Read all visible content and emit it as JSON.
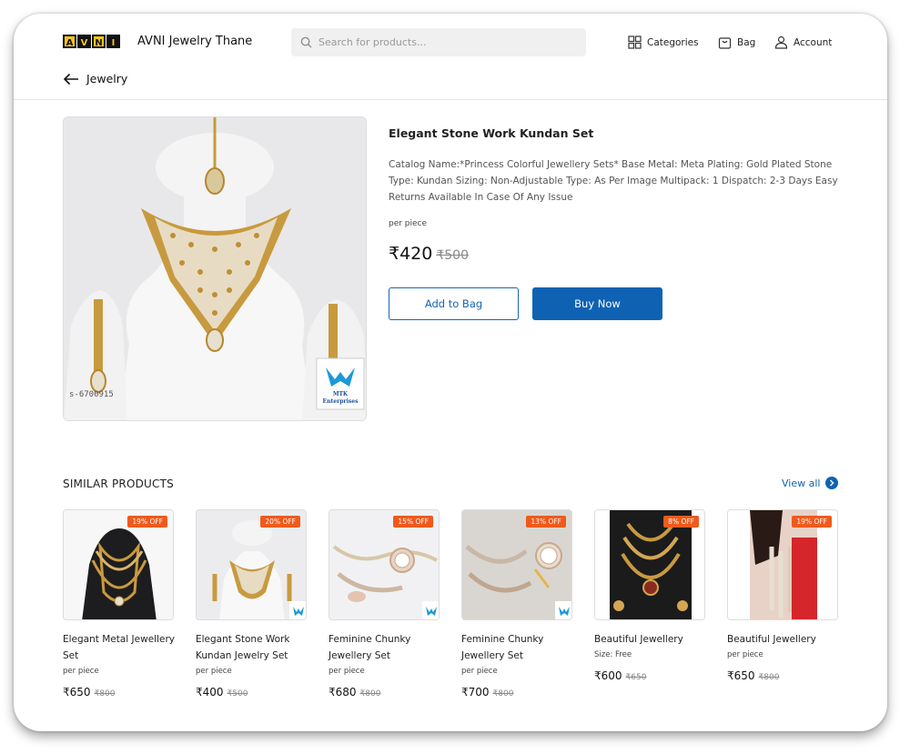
{
  "header": {
    "logo_letters": [
      "A",
      "V",
      "N",
      "I"
    ],
    "store_name": "AVNI Jewelry Thane",
    "search_placeholder": "Search for products...",
    "nav": {
      "categories": "Categories",
      "bag": "Bag",
      "account": "Account"
    },
    "back_label": "Jewelry"
  },
  "product": {
    "title": "Elegant Stone Work Kundan Set",
    "description": "Catalog Name:*Princess Colorful Jewellery Sets* Base Metal: Meta Plating: Gold Plated Stone Type: Kundan Sizing: Non-Adjustable Type: As Per Image Multipack: 1 Dispatch: 2-3 Days Easy Returns Available In Case Of Any Issue",
    "unit": "per piece",
    "price": "₹420",
    "mrp": "₹500",
    "image_id_watermark": "s-6700915",
    "image_brand_line1": "MTK",
    "image_brand_line2": "Enterprises",
    "add_to_bag": "Add to Bag",
    "buy_now": "Buy Now"
  },
  "similar": {
    "title": "SIMILAR PRODUCTS",
    "view_all": "View all",
    "items": [
      {
        "name": "Elegant Metal Jewellery Set",
        "sub": "per piece",
        "price": "₹650",
        "mrp": "₹800",
        "discount": "19% OFF"
      },
      {
        "name": "Elegant Stone Work Kundan Jewelry Set",
        "sub": "per piece",
        "price": "₹400",
        "mrp": "₹500",
        "discount": "20% OFF"
      },
      {
        "name": "Feminine Chunky Jewellery Set",
        "sub": "per piece",
        "price": "₹680",
        "mrp": "₹800",
        "discount": "15% OFF"
      },
      {
        "name": "Feminine Chunky Jewellery Set",
        "sub": "per piece",
        "price": "₹700",
        "mrp": "₹800",
        "discount": "13% OFF"
      },
      {
        "name": "Beautiful Jewellery",
        "sub": "Size: Free",
        "price": "₹600",
        "mrp": "₹650",
        "discount": "8% OFF"
      },
      {
        "name": "Beautiful Jewellery",
        "sub": "per piece",
        "price": "₹650",
        "mrp": "₹800",
        "discount": "19% OFF"
      }
    ]
  },
  "colors": {
    "primary": "#0f62b3",
    "discount_badge": "#ef5a1c",
    "logo_yellow": "#f5c518"
  }
}
